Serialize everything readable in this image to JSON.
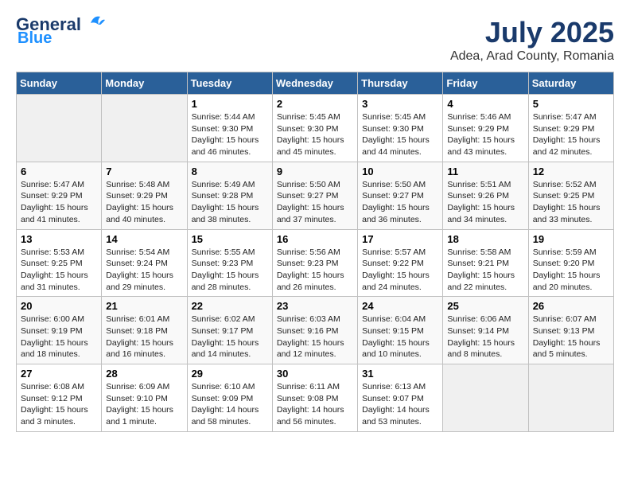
{
  "logo": {
    "line1": "General",
    "line2": "Blue"
  },
  "title": "July 2025",
  "subtitle": "Adea, Arad County, Romania",
  "weekdays": [
    "Sunday",
    "Monday",
    "Tuesday",
    "Wednesday",
    "Thursday",
    "Friday",
    "Saturday"
  ],
  "weeks": [
    [
      {
        "day": "",
        "info": ""
      },
      {
        "day": "",
        "info": ""
      },
      {
        "day": "1",
        "info": "Sunrise: 5:44 AM\nSunset: 9:30 PM\nDaylight: 15 hours\nand 46 minutes."
      },
      {
        "day": "2",
        "info": "Sunrise: 5:45 AM\nSunset: 9:30 PM\nDaylight: 15 hours\nand 45 minutes."
      },
      {
        "day": "3",
        "info": "Sunrise: 5:45 AM\nSunset: 9:30 PM\nDaylight: 15 hours\nand 44 minutes."
      },
      {
        "day": "4",
        "info": "Sunrise: 5:46 AM\nSunset: 9:29 PM\nDaylight: 15 hours\nand 43 minutes."
      },
      {
        "day": "5",
        "info": "Sunrise: 5:47 AM\nSunset: 9:29 PM\nDaylight: 15 hours\nand 42 minutes."
      }
    ],
    [
      {
        "day": "6",
        "info": "Sunrise: 5:47 AM\nSunset: 9:29 PM\nDaylight: 15 hours\nand 41 minutes."
      },
      {
        "day": "7",
        "info": "Sunrise: 5:48 AM\nSunset: 9:29 PM\nDaylight: 15 hours\nand 40 minutes."
      },
      {
        "day": "8",
        "info": "Sunrise: 5:49 AM\nSunset: 9:28 PM\nDaylight: 15 hours\nand 38 minutes."
      },
      {
        "day": "9",
        "info": "Sunrise: 5:50 AM\nSunset: 9:27 PM\nDaylight: 15 hours\nand 37 minutes."
      },
      {
        "day": "10",
        "info": "Sunrise: 5:50 AM\nSunset: 9:27 PM\nDaylight: 15 hours\nand 36 minutes."
      },
      {
        "day": "11",
        "info": "Sunrise: 5:51 AM\nSunset: 9:26 PM\nDaylight: 15 hours\nand 34 minutes."
      },
      {
        "day": "12",
        "info": "Sunrise: 5:52 AM\nSunset: 9:25 PM\nDaylight: 15 hours\nand 33 minutes."
      }
    ],
    [
      {
        "day": "13",
        "info": "Sunrise: 5:53 AM\nSunset: 9:25 PM\nDaylight: 15 hours\nand 31 minutes."
      },
      {
        "day": "14",
        "info": "Sunrise: 5:54 AM\nSunset: 9:24 PM\nDaylight: 15 hours\nand 29 minutes."
      },
      {
        "day": "15",
        "info": "Sunrise: 5:55 AM\nSunset: 9:23 PM\nDaylight: 15 hours\nand 28 minutes."
      },
      {
        "day": "16",
        "info": "Sunrise: 5:56 AM\nSunset: 9:23 PM\nDaylight: 15 hours\nand 26 minutes."
      },
      {
        "day": "17",
        "info": "Sunrise: 5:57 AM\nSunset: 9:22 PM\nDaylight: 15 hours\nand 24 minutes."
      },
      {
        "day": "18",
        "info": "Sunrise: 5:58 AM\nSunset: 9:21 PM\nDaylight: 15 hours\nand 22 minutes."
      },
      {
        "day": "19",
        "info": "Sunrise: 5:59 AM\nSunset: 9:20 PM\nDaylight: 15 hours\nand 20 minutes."
      }
    ],
    [
      {
        "day": "20",
        "info": "Sunrise: 6:00 AM\nSunset: 9:19 PM\nDaylight: 15 hours\nand 18 minutes."
      },
      {
        "day": "21",
        "info": "Sunrise: 6:01 AM\nSunset: 9:18 PM\nDaylight: 15 hours\nand 16 minutes."
      },
      {
        "day": "22",
        "info": "Sunrise: 6:02 AM\nSunset: 9:17 PM\nDaylight: 15 hours\nand 14 minutes."
      },
      {
        "day": "23",
        "info": "Sunrise: 6:03 AM\nSunset: 9:16 PM\nDaylight: 15 hours\nand 12 minutes."
      },
      {
        "day": "24",
        "info": "Sunrise: 6:04 AM\nSunset: 9:15 PM\nDaylight: 15 hours\nand 10 minutes."
      },
      {
        "day": "25",
        "info": "Sunrise: 6:06 AM\nSunset: 9:14 PM\nDaylight: 15 hours\nand 8 minutes."
      },
      {
        "day": "26",
        "info": "Sunrise: 6:07 AM\nSunset: 9:13 PM\nDaylight: 15 hours\nand 5 minutes."
      }
    ],
    [
      {
        "day": "27",
        "info": "Sunrise: 6:08 AM\nSunset: 9:12 PM\nDaylight: 15 hours\nand 3 minutes."
      },
      {
        "day": "28",
        "info": "Sunrise: 6:09 AM\nSunset: 9:10 PM\nDaylight: 15 hours\nand 1 minute."
      },
      {
        "day": "29",
        "info": "Sunrise: 6:10 AM\nSunset: 9:09 PM\nDaylight: 14 hours\nand 58 minutes."
      },
      {
        "day": "30",
        "info": "Sunrise: 6:11 AM\nSunset: 9:08 PM\nDaylight: 14 hours\nand 56 minutes."
      },
      {
        "day": "31",
        "info": "Sunrise: 6:13 AM\nSunset: 9:07 PM\nDaylight: 14 hours\nand 53 minutes."
      },
      {
        "day": "",
        "info": ""
      },
      {
        "day": "",
        "info": ""
      }
    ]
  ]
}
